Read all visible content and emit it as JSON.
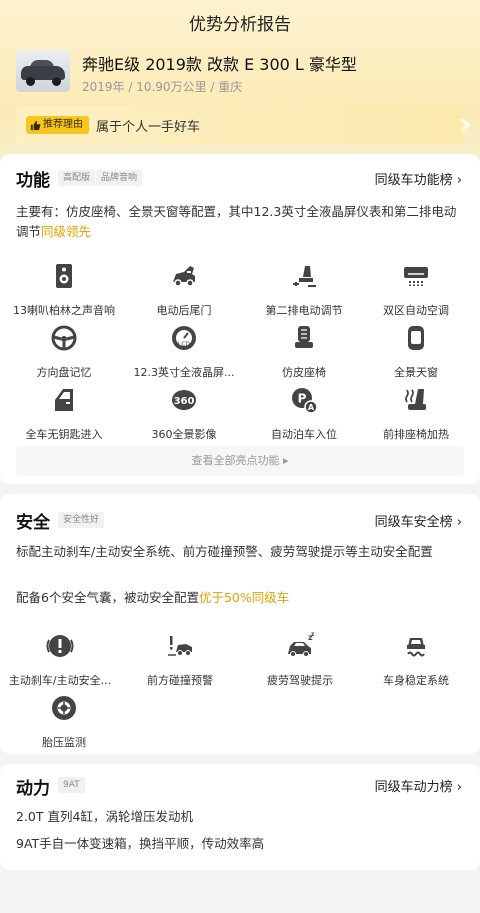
{
  "header": {
    "title": "优势分析报告"
  },
  "car": {
    "name": "奔驰E级 2019款 改款 E 300 L 豪华型",
    "meta": "2019年 / 10.90万公里 / 重庆"
  },
  "reason": {
    "tag": "推荐理由",
    "text": "属于个人一手好车"
  },
  "feature": {
    "title": "功能",
    "chips": [
      "高配版",
      "品牌音响"
    ],
    "rank": "同级车功能榜",
    "desc": "主要有：仿皮座椅、全景天窗等配置，其中12.3英寸全液晶屏仪表和第二排电动调节",
    "desc_hl": "同级领先",
    "items": [
      {
        "label": "13喇叭柏林之声音响",
        "icon": "speaker-icon"
      },
      {
        "label": "电动后尾门",
        "icon": "power-tailgate-icon"
      },
      {
        "label": "第二排电动调节",
        "icon": "seat-adjust-icon"
      },
      {
        "label": "双区自动空调",
        "icon": "air-conditioner-icon"
      },
      {
        "label": "方向盘记忆",
        "icon": "steering-wheel-icon"
      },
      {
        "label": "12.3英寸全液晶屏...",
        "icon": "lcd-gauge-icon"
      },
      {
        "label": "仿皮座椅",
        "icon": "leather-seat-icon"
      },
      {
        "label": "全景天窗",
        "icon": "sunroof-icon"
      },
      {
        "label": "全车无钥匙进入",
        "icon": "car-door-icon"
      },
      {
        "label": "360全景影像",
        "icon": "camera-360-icon"
      },
      {
        "label": "自动泊车入位",
        "icon": "auto-parking-icon"
      },
      {
        "label": "前排座椅加热",
        "icon": "seat-heating-icon"
      }
    ],
    "view_all": "查看全部亮点功能 ▸"
  },
  "safety": {
    "title": "安全",
    "chip": "安全性好",
    "rank": "同级车安全榜",
    "desc1": "标配主动刹车/主动安全系统、前方碰撞预警、疲劳驾驶提示等主动安全配置",
    "desc2": "配备6个安全气囊，被动安全配置",
    "desc2_hl": "优于50%同级车",
    "items": [
      {
        "label": "主动刹车/主动安全...",
        "icon": "brake-warning-icon"
      },
      {
        "label": "前方碰撞预警",
        "icon": "collision-warning-icon"
      },
      {
        "label": "疲劳驾驶提示",
        "icon": "fatigue-alert-icon"
      },
      {
        "label": "车身稳定系统",
        "icon": "stability-control-icon"
      },
      {
        "label": "胎压监测",
        "icon": "tire-pressure-icon"
      }
    ]
  },
  "power": {
    "title": "动力",
    "chip": "9AT",
    "rank": "同级车动力榜",
    "line1": "2.0T 直列4缸，涡轮增压发动机",
    "line2": "9AT手自一体变速箱，换挡平顺，传动效率高"
  },
  "colors": {
    "accent": "#e3a100",
    "tag": "#f8c61d",
    "icon": "#444444"
  }
}
